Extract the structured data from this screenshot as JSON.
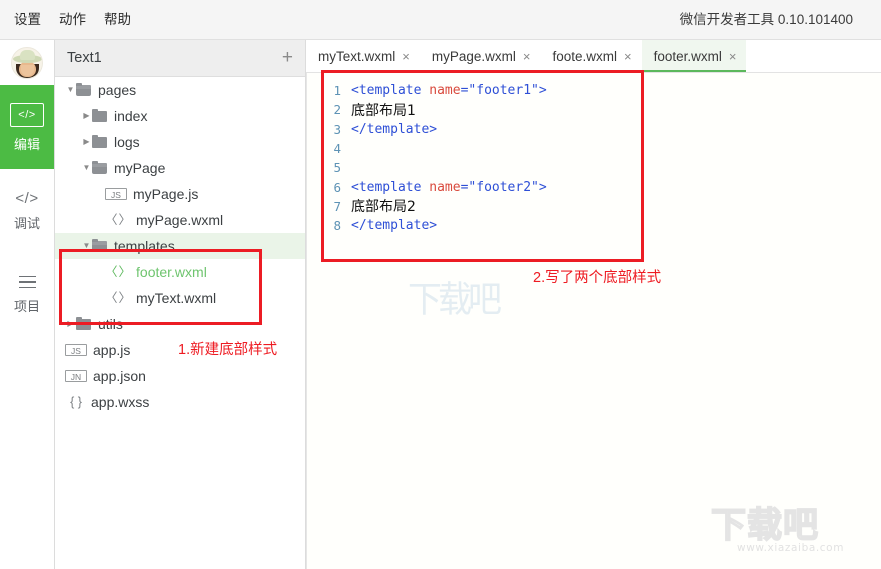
{
  "menubar": {
    "items": [
      {
        "label": "设置"
      },
      {
        "label": "动作"
      },
      {
        "label": "帮助"
      }
    ],
    "app_title": "微信开发者工具 0.10.101400"
  },
  "rail": {
    "items": [
      {
        "label": "编辑",
        "icon": "code-icon",
        "active": true
      },
      {
        "label": "调试",
        "icon": "code-icon",
        "active": false
      },
      {
        "label": "项目",
        "icon": "menu-icon",
        "active": false
      }
    ],
    "active_color": "#4cbb44"
  },
  "filepanel": {
    "title": "Text1",
    "add_label": "+",
    "tree": [
      {
        "label": "pages",
        "type": "folder",
        "indent": 0,
        "expanded": true,
        "selected": false
      },
      {
        "label": "index",
        "type": "folder",
        "indent": 1,
        "expanded": false,
        "selected": false
      },
      {
        "label": "logs",
        "type": "folder",
        "indent": 1,
        "expanded": false,
        "selected": false
      },
      {
        "label": "myPage",
        "type": "folder",
        "indent": 1,
        "expanded": true,
        "selected": false
      },
      {
        "label": "myPage.js",
        "type": "js",
        "indent": 2,
        "selected": false
      },
      {
        "label": "myPage.wxml",
        "type": "wxml",
        "indent": 2,
        "selected": false
      },
      {
        "label": "templates",
        "type": "folder",
        "indent": 1,
        "expanded": true,
        "selected": true
      },
      {
        "label": "footer.wxml",
        "type": "wxml",
        "indent": 2,
        "selected": false,
        "green": true
      },
      {
        "label": "myText.wxml",
        "type": "wxml",
        "indent": 2,
        "selected": false
      },
      {
        "label": "utils",
        "type": "folder",
        "indent": 0,
        "expanded": false,
        "selected": false
      },
      {
        "label": "app.js",
        "type": "js",
        "indent": 0,
        "selected": false
      },
      {
        "label": "app.json",
        "type": "json",
        "indent": 0,
        "selected": false
      },
      {
        "label": "app.wxss",
        "type": "wxss",
        "indent": 0,
        "selected": false
      }
    ],
    "icon_text": {
      "js": "JS",
      "json": "JN",
      "wxml": "〈〉",
      "wxss": "{ }"
    }
  },
  "editor": {
    "tabs": [
      {
        "label": "myText.wxml",
        "close": "×",
        "active": false
      },
      {
        "label": "myPage.wxml",
        "close": "×",
        "active": false
      },
      {
        "label": "foote.wxml",
        "close": "×",
        "active": false
      },
      {
        "label": "footer.wxml",
        "close": "×",
        "active": true
      }
    ],
    "code": [
      {
        "num": "1",
        "parts": [
          {
            "t": "tag",
            "s": "<template "
          },
          {
            "t": "attr",
            "s": "name"
          },
          {
            "t": "tag",
            "s": "="
          },
          {
            "t": "str",
            "s": "\"footer1\""
          },
          {
            "t": "tag",
            "s": ">"
          }
        ]
      },
      {
        "num": "2",
        "parts": [
          {
            "t": "txt",
            "s": "底部布局1"
          }
        ]
      },
      {
        "num": "3",
        "parts": [
          {
            "t": "tag",
            "s": "</template>"
          }
        ]
      },
      {
        "num": "4",
        "parts": []
      },
      {
        "num": "5",
        "parts": []
      },
      {
        "num": "6",
        "parts": [
          {
            "t": "tag",
            "s": "<template "
          },
          {
            "t": "attr",
            "s": "name"
          },
          {
            "t": "tag",
            "s": "="
          },
          {
            "t": "str",
            "s": "\"footer2\""
          },
          {
            "t": "tag",
            "s": ">"
          }
        ]
      },
      {
        "num": "7",
        "parts": [
          {
            "t": "txt",
            "s": "底部布局2"
          }
        ]
      },
      {
        "num": "8",
        "parts": [
          {
            "t": "tag",
            "s": "</template>"
          }
        ]
      }
    ]
  },
  "annotations": {
    "box_color": "#ec1c24",
    "note1": "1.新建底部样式",
    "note2": "2.写了两个底部样式"
  },
  "watermarks": {
    "center": "下载吧",
    "logo_text": "下载吧",
    "logo_url": "www.xiazaiba.com"
  }
}
